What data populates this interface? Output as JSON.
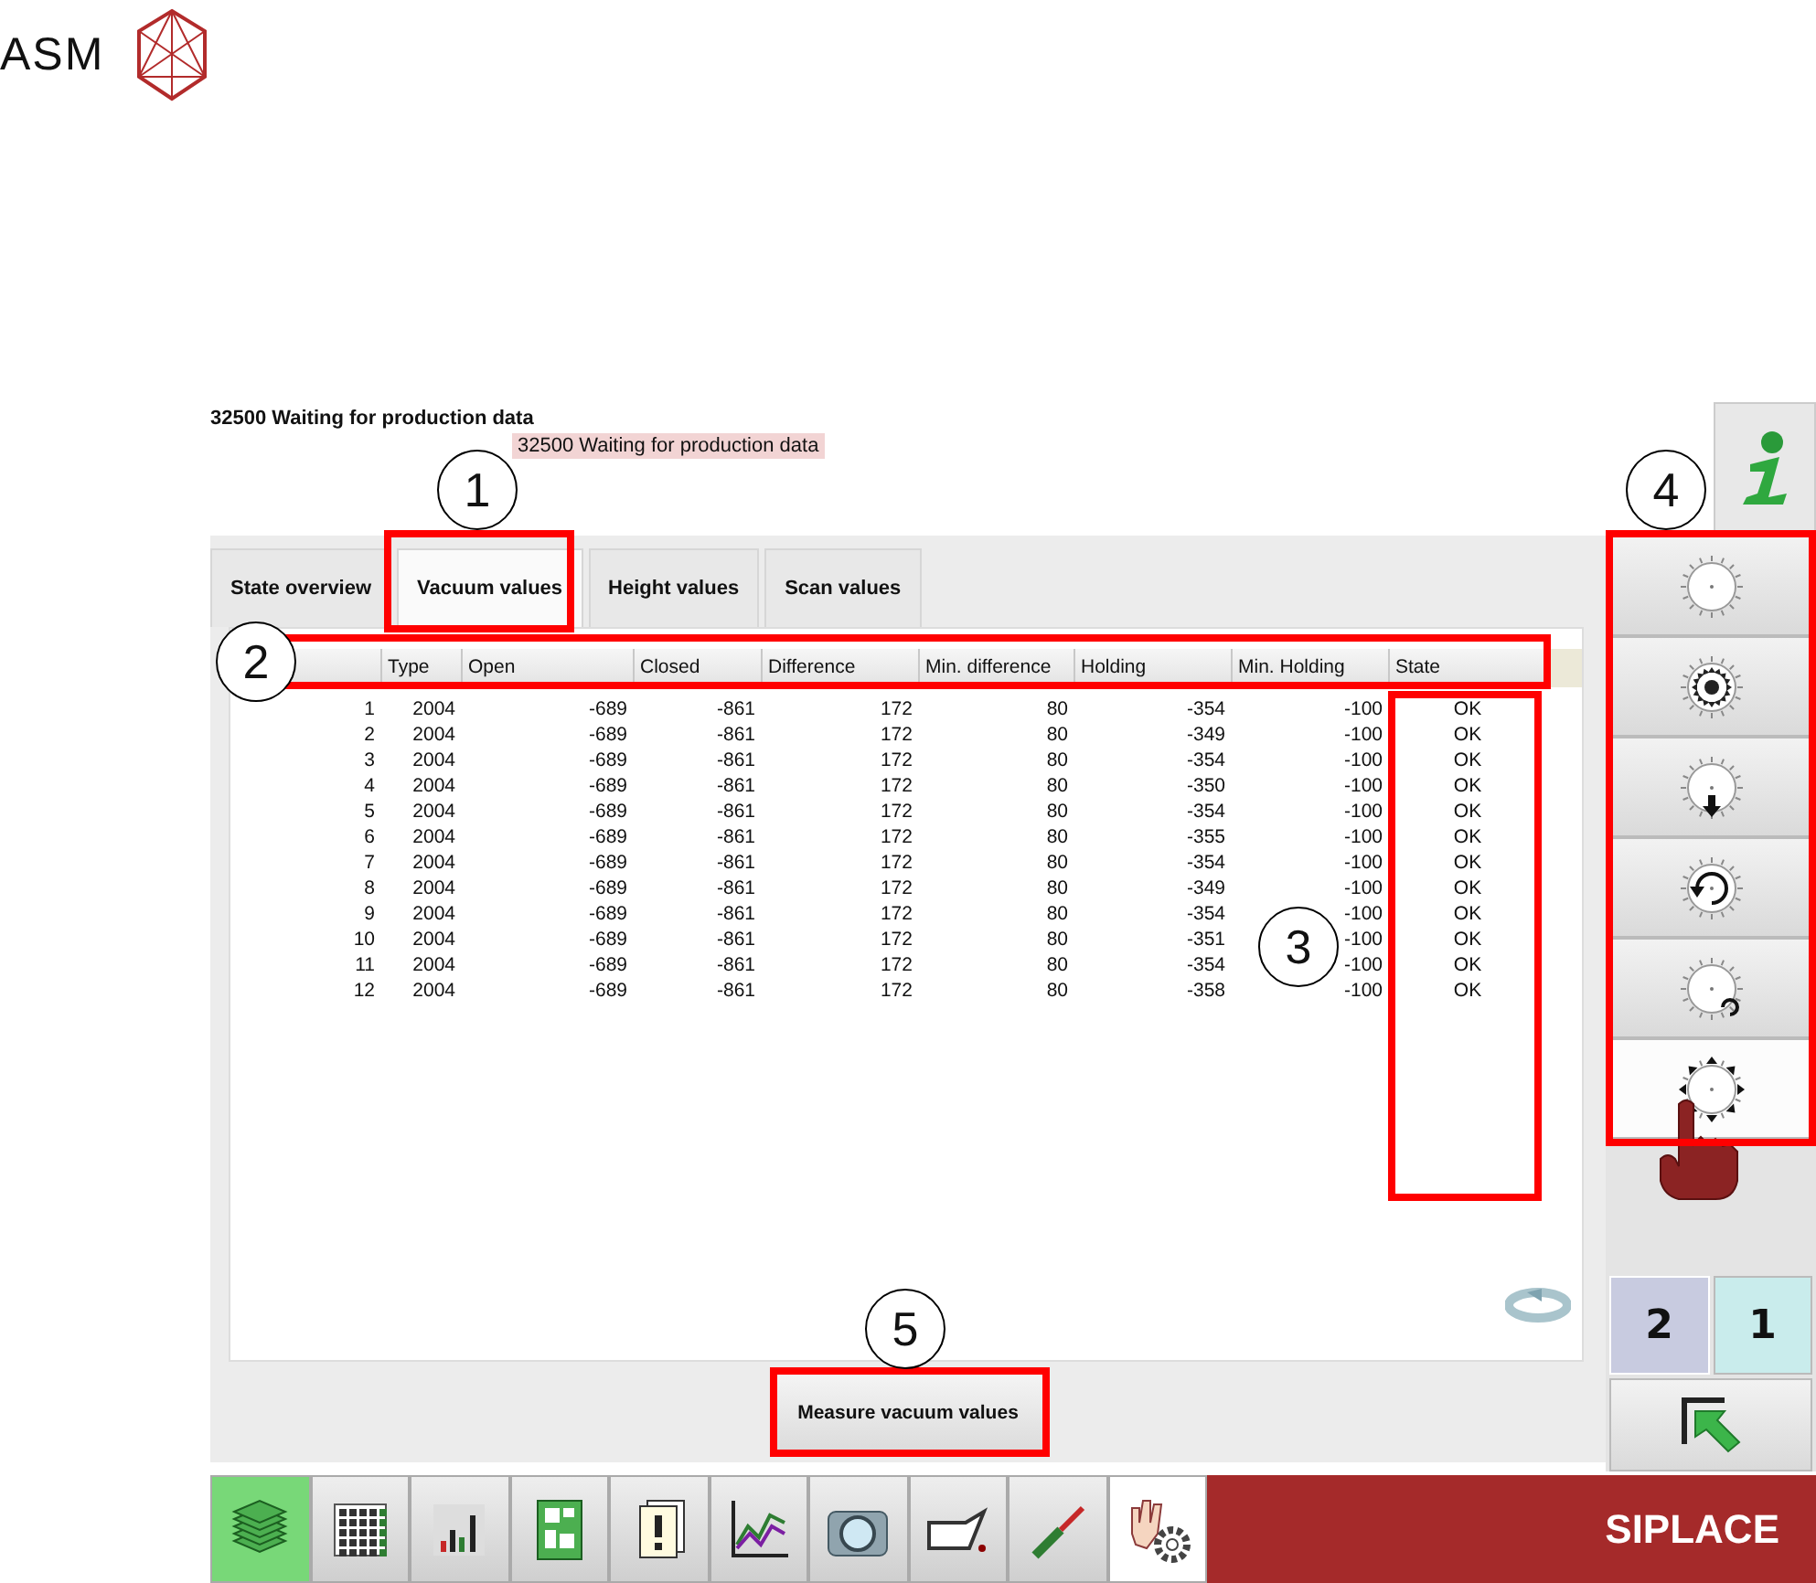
{
  "logo": {
    "text": "ASM"
  },
  "status": {
    "message": "32500 Waiting for production data",
    "tooltip": "32500 Waiting for production data"
  },
  "tabs": [
    {
      "label": "State overview",
      "selected": false
    },
    {
      "label": "Vacuum values",
      "selected": true
    },
    {
      "label": "Height values",
      "selected": false
    },
    {
      "label": "Scan values",
      "selected": false
    }
  ],
  "table": {
    "columns": [
      "Type",
      "Open",
      "Closed",
      "Difference",
      "Min. difference",
      "Holding",
      "Min. Holding",
      "State"
    ],
    "rows": [
      {
        "cells": [
          "1",
          "2004",
          "-689",
          "-861",
          "172",
          "80",
          "-354",
          "-100",
          "OK"
        ]
      },
      {
        "cells": [
          "2",
          "2004",
          "-689",
          "-861",
          "172",
          "80",
          "-349",
          "-100",
          "OK"
        ]
      },
      {
        "cells": [
          "3",
          "2004",
          "-689",
          "-861",
          "172",
          "80",
          "-354",
          "-100",
          "OK"
        ]
      },
      {
        "cells": [
          "4",
          "2004",
          "-689",
          "-861",
          "172",
          "80",
          "-350",
          "-100",
          "OK"
        ]
      },
      {
        "cells": [
          "5",
          "2004",
          "-689",
          "-861",
          "172",
          "80",
          "-354",
          "-100",
          "OK"
        ]
      },
      {
        "cells": [
          "6",
          "2004",
          "-689",
          "-861",
          "172",
          "80",
          "-355",
          "-100",
          "OK"
        ]
      },
      {
        "cells": [
          "7",
          "2004",
          "-689",
          "-861",
          "172",
          "80",
          "-354",
          "-100",
          "OK"
        ]
      },
      {
        "cells": [
          "8",
          "2004",
          "-689",
          "-861",
          "172",
          "80",
          "-349",
          "-100",
          "OK"
        ]
      },
      {
        "cells": [
          "9",
          "2004",
          "-689",
          "-861",
          "172",
          "80",
          "-354",
          "-100",
          "OK"
        ]
      },
      {
        "cells": [
          "10",
          "2004",
          "-689",
          "-861",
          "172",
          "80",
          "-351",
          "-100",
          "OK"
        ]
      },
      {
        "cells": [
          "11",
          "2004",
          "-689",
          "-861",
          "172",
          "80",
          "-354",
          "-100",
          "OK"
        ]
      },
      {
        "cells": [
          "12",
          "2004",
          "-689",
          "-861",
          "172",
          "80",
          "-358",
          "-100",
          "OK"
        ]
      }
    ]
  },
  "action_button": {
    "label": "Measure vacuum values"
  },
  "side_buttons": [
    {
      "selected": false
    },
    {
      "selected": false
    },
    {
      "selected": false
    },
    {
      "selected": false
    },
    {
      "selected": false
    },
    {
      "selected": true
    }
  ],
  "layer_toggle": [
    {
      "label": "2",
      "selected": true
    },
    {
      "label": "1",
      "selected": false
    }
  ],
  "taskbar": [
    {
      "selected": false,
      "highlighted": true
    },
    {
      "selected": false,
      "highlighted": false
    },
    {
      "selected": false,
      "highlighted": false
    },
    {
      "selected": false,
      "highlighted": false
    },
    {
      "selected": false,
      "highlighted": false
    },
    {
      "selected": false,
      "highlighted": false
    },
    {
      "selected": false,
      "highlighted": false
    },
    {
      "selected": false,
      "highlighted": false
    },
    {
      "selected": false,
      "highlighted": false
    },
    {
      "selected": true,
      "highlighted": false
    }
  ],
  "brand": "SIPLACE",
  "callouts": [
    {
      "number": "1"
    },
    {
      "number": "2"
    },
    {
      "number": "3"
    },
    {
      "number": "4"
    },
    {
      "number": "5"
    }
  ]
}
